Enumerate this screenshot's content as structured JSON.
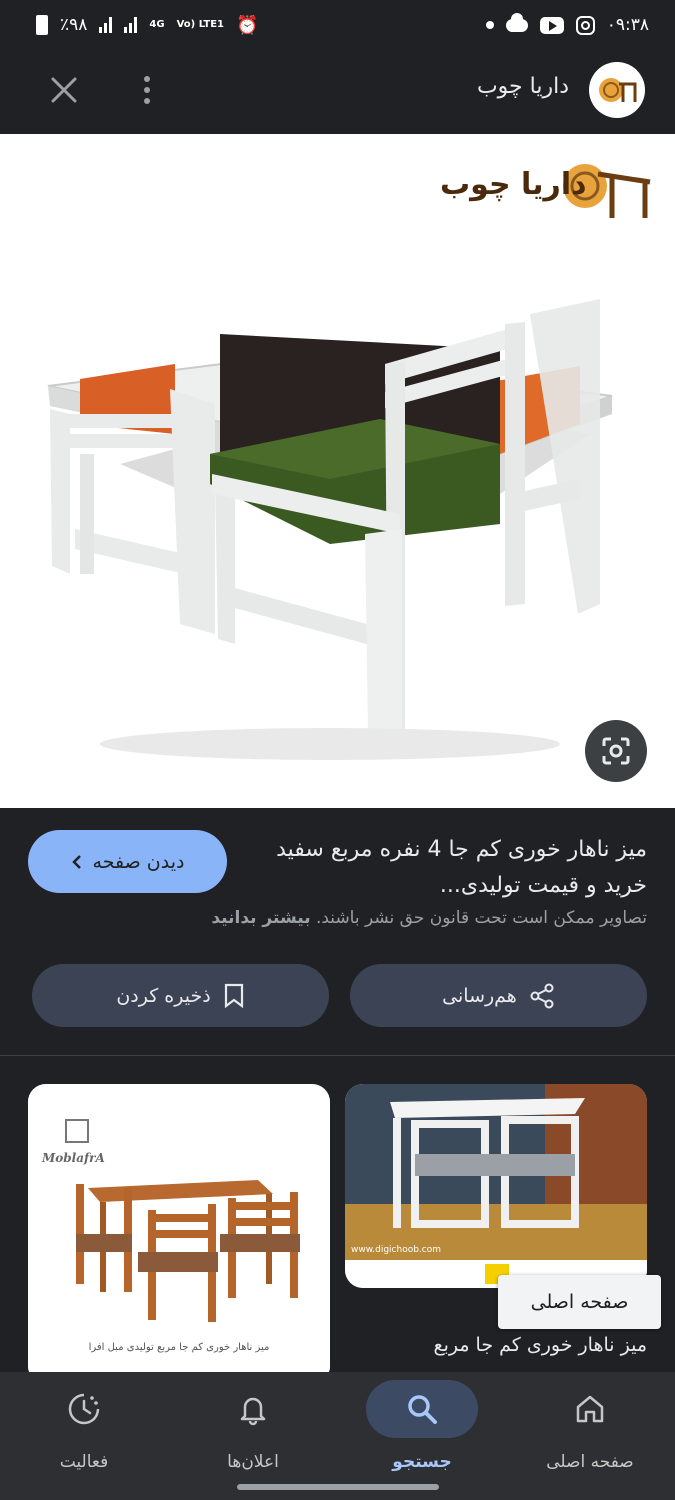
{
  "status_bar": {
    "time": "۰۹:۳۸",
    "battery": "٪۹۸",
    "network": "4G",
    "volte": "Vo) LTE1"
  },
  "header": {
    "site_name": "داریا چوب",
    "logo_icon": "daria-choob-logo-icon"
  },
  "image": {
    "brand_watermark": "داریا چوب"
  },
  "result": {
    "title": "میز ناهار خوری کم جا 4 نفره مربع سفید خرید و قیمت تولیدی...",
    "visit_label": "دیدن صفحه",
    "copyright_text": "تصاویر ممکن است تحت قانون حق نشر باشند.",
    "learn_more": "بیشتر بدانید",
    "share_label": "هم‌رسانی",
    "save_label": "ذخیره کردن"
  },
  "related": {
    "caption": "میز ناهار خوری کم جا مربع",
    "tooltip": "صفحه اصلی",
    "left_card_brand": "MoblafrA",
    "left_card_caption": "میز ناهار خوری کم جا مربع تولیدی مبل افرا",
    "right_card_url": "www.digichoob.com"
  },
  "nav": {
    "items": [
      {
        "label": "صفحه اصلی",
        "icon": "home-icon"
      },
      {
        "label": "جستجو",
        "icon": "search-icon"
      },
      {
        "label": "اعلان‌ها",
        "icon": "bell-icon"
      },
      {
        "label": "فعالیت",
        "icon": "activity-icon"
      }
    ],
    "active_index": 1
  },
  "colors": {
    "background": "#202124",
    "accent": "#8ab4f8",
    "button": "#3c4354",
    "nav_bg": "#2d2f33"
  }
}
